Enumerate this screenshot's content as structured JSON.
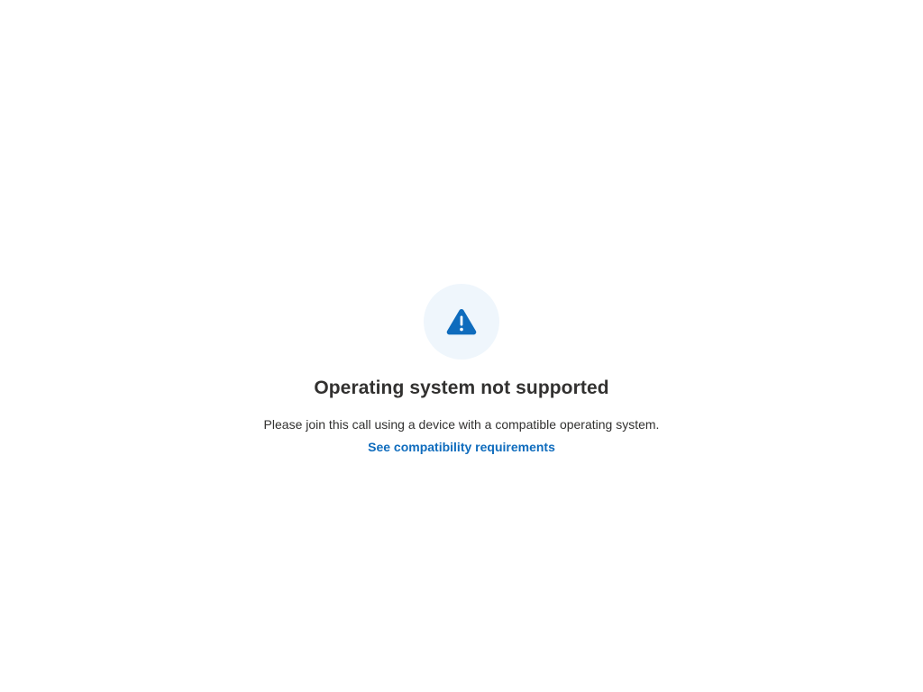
{
  "error": {
    "icon": "warning-icon",
    "icon_color": "#0f6cbd",
    "icon_bg_color": "#eff6fc",
    "title": "Operating system not supported",
    "message": "Please join this call using a device with a compatible operating system.",
    "link_label": "See compatibility requirements",
    "link_color": "#0f6cbd"
  }
}
